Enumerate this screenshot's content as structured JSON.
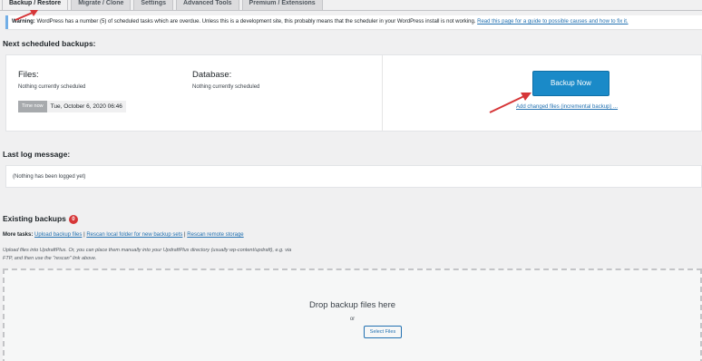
{
  "tabs": [
    {
      "label": "Backup / Restore"
    },
    {
      "label": "Migrate / Clone"
    },
    {
      "label": "Settings"
    },
    {
      "label": "Advanced Tools"
    },
    {
      "label": "Premium / Extensions"
    }
  ],
  "notice": {
    "prefix": "Warning:",
    "text": " WordPress has a number (5) of scheduled tasks which are overdue. Unless this is a development site, this probably means that the scheduler in your WordPress install is not working. ",
    "link": "Read this page for a guide to possible causes and how to fix it."
  },
  "scheduled": {
    "heading": "Next scheduled backups:",
    "files_title": "Files:",
    "files_text": "Nothing currently scheduled",
    "db_title": "Database:",
    "db_text": "Nothing currently scheduled",
    "time_label": "Time now",
    "time_value": "Tue, October 6, 2020 06:46",
    "backup_now": "Backup Now",
    "incremental_link": "Add changed files (incremental backup) ..."
  },
  "log": {
    "heading": "Last log message:",
    "text": "(Nothing has been logged yet)"
  },
  "existing": {
    "heading": "Existing backups",
    "count": "0",
    "more_tasks_label": "More tasks:",
    "upload_link": "Upload backup files",
    "rescan_local": "Rescan local folder for new backup sets",
    "rescan_remote": "Rescan remote storage",
    "sep": " | ",
    "upload_note": "Upload files into UpdraftPlus. Or, you can place them manually into your UpdraftPlus directory (usually wp-content/updraft), e.g. via FTP, and then use the \"rescan\" link above."
  },
  "dropzone": {
    "title": "Drop backup files here",
    "or": "or",
    "select_files": "Select Files"
  },
  "colors": {
    "accent": "#1a8ac8",
    "link": "#2271b1",
    "arrow": "#d63638",
    "badge": "#d63638"
  }
}
